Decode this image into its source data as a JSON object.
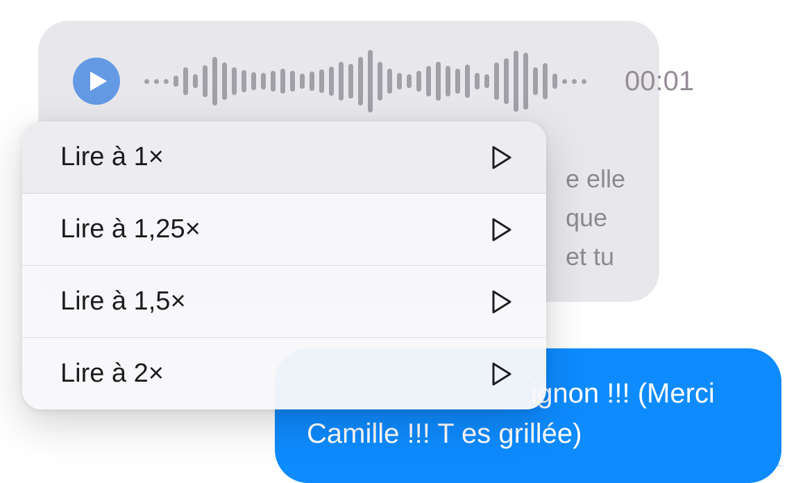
{
  "audio": {
    "timestamp": "00:01",
    "waveform_heights": [
      7,
      7,
      7,
      16,
      40,
      20,
      46,
      70,
      54,
      40,
      32,
      26,
      24,
      30,
      36,
      30,
      22,
      28,
      34,
      42,
      56,
      50,
      70,
      90,
      56,
      36,
      24,
      20,
      30,
      44,
      56,
      44,
      36,
      48,
      24,
      20,
      54,
      66,
      88,
      82,
      40,
      52,
      22,
      7,
      7,
      7
    ]
  },
  "partial_text": {
    "line1": "e elle",
    "line2": "que",
    "line3": "et tu"
  },
  "sent_message": {
    "line1": "ignon !!! (Merci",
    "line2": "Camille !!! T es grillée)"
  },
  "speed_menu": {
    "items": [
      {
        "label": "Lire à 1×"
      },
      {
        "label": "Lire à 1,25×"
      },
      {
        "label": "Lire à 1,5×"
      },
      {
        "label": "Lire à 2×"
      }
    ]
  }
}
